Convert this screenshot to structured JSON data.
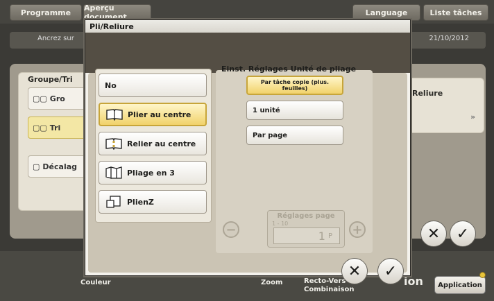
{
  "background": {
    "top_tabs": [
      "Programme",
      "Aperçu document",
      "Language",
      "Liste tâches"
    ],
    "date_text": "21/10/2012",
    "bar_text": "Ancrez sur",
    "group_title": "Groupe/Tri",
    "group_item_1": "Gro",
    "group_item_2": "Tri",
    "offset_item": "Décalag",
    "right_item": "Reliure",
    "bottom": {
      "color_label": "Couleur",
      "zoom_label": "Zoom",
      "duplex_label_1": "Recto-Vers",
      "duplex_label_2": "Combinaison",
      "small_text": "ion",
      "application_label": "Application"
    }
  },
  "modal": {
    "title": "Pli/Reliure",
    "options": [
      {
        "label": "No",
        "icon": "none"
      },
      {
        "label": "Plier au centre",
        "icon": "fold-center-icon",
        "selected": true
      },
      {
        "label": "Relier au centre",
        "icon": "staple-center-icon"
      },
      {
        "label": "Pliage en 3",
        "icon": "tri-fold-icon"
      },
      {
        "label": "PlienZ",
        "icon": "z-fold-icon"
      }
    ],
    "unit": {
      "title": "Einst. Réglages Unité de pliage",
      "options": [
        {
          "label": "Par tâche copie (plus. feuilles)",
          "selected": true
        },
        {
          "label": "1 unité"
        },
        {
          "label": "Par page"
        }
      ]
    },
    "pages": {
      "title": "Réglages page",
      "range": "1 - 10",
      "value": "1",
      "unit": "P"
    }
  },
  "colors": {
    "selected_fill": "#f1d26b",
    "selected_border": "#c7a53a",
    "background_dark": "#3b3a36"
  }
}
